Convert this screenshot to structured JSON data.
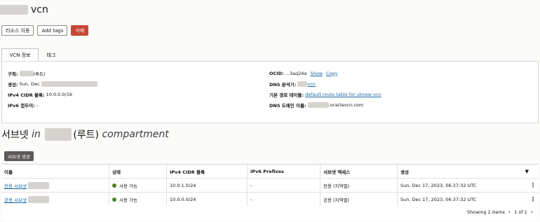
{
  "header": {
    "title": "vcn"
  },
  "actions": {
    "move": "리소스 이동",
    "tags": "Add tags",
    "delete": "삭제"
  },
  "tabs": [
    "VCN 정보",
    "태그"
  ],
  "details": {
    "compartment_label": "구획:",
    "compartment_value": "(루트)",
    "created_label": "생성:",
    "created_value": "Sun, Dec",
    "cidr_label": "IPv4 CIDR 블록:",
    "cidr_value": "10.0.0.0/16",
    "ipv6_label": "IPv6 접두어:",
    "ipv6_value": "-",
    "ocid_label": "OCID:",
    "ocid_value": "...3aq24a",
    "ocid_show": "Show",
    "ocid_copy": "Copy",
    "dns_resolver_label": "DNS 분석기:",
    "dns_resolver_value": "vcn",
    "route_table_label": "기본 경로 테이블:",
    "route_table_value": "default route table for uknew vcn",
    "dns_domain_label": "DNS 도메인 이름:",
    "dns_domain_value": ".oraclevcn.com"
  },
  "subnets": {
    "heading_prefix": "서브넷",
    "heading_in": "in",
    "heading_suffix": "(루트)",
    "heading_compartment": "compartment",
    "create_button": "서브넷 생성",
    "columns": [
      "이름",
      "상태",
      "IPv4 CIDR 블록",
      "IPv6 Prefixes",
      "서브넷 액세스",
      "생성"
    ],
    "rows": [
      {
        "name": "전용 서브넷",
        "status": "사용 가능",
        "cidr": "10.0.1.0/24",
        "ipv6": "-",
        "access": "전용 (지역별)",
        "created": "Sun, Dec 17, 2023, 06:37:32 UTC"
      },
      {
        "name": "공용 서브넷",
        "status": "사용 가능",
        "cidr": "10.0.0.0/24",
        "ipv6": "-",
        "access": "공용 (지역별)",
        "created": "Sun, Dec 17, 2023, 06:37:32 UTC"
      }
    ],
    "footer": "Showing 2 items",
    "pager": "1 of 1"
  },
  "colors": {
    "danger": "#c74634",
    "link": "#1b67a8",
    "available": "#508223"
  }
}
